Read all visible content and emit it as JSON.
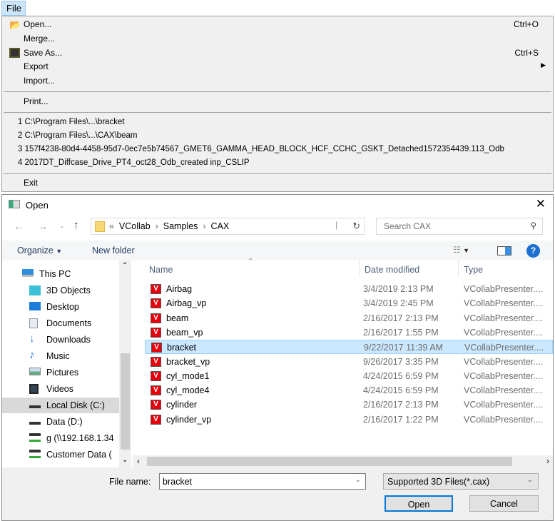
{
  "menubar": {
    "file_label": "File"
  },
  "file_menu": {
    "items": [
      {
        "label": "Open...",
        "shortcut": "Ctrl+O",
        "icon": "open-folder-icon"
      },
      {
        "label": "Merge..."
      },
      {
        "label": "Save As...",
        "shortcut": "Ctrl+S",
        "icon": "floppy-disk-icon"
      },
      {
        "label": "Export",
        "submenu": true
      },
      {
        "label": "Import..."
      }
    ],
    "print_label": "Print...",
    "recent": [
      "1 C:\\Program Files\\...\\bracket",
      "2 C:\\Program Files\\...\\CAX\\beam",
      "3 157f4238-80d4-4458-95d7-0ec7e5b74567_GMET6_GAMMA_HEAD_BLOCK_HCF_CCHC_GSKT_Detached1572354439.113_Odb",
      "4 2017DT_Diffcase_Drive_PT4_oct28_Odb_created inp_CSLIP"
    ],
    "exit_label": "Exit"
  },
  "dialog": {
    "title": "Open",
    "breadcrumb": {
      "overflow": "«",
      "parts": [
        "VCollab",
        "Samples",
        "CAX"
      ]
    },
    "search_placeholder": "Search CAX",
    "toolbar": {
      "organize": "Organize",
      "new_folder": "New folder"
    },
    "nav": [
      {
        "label": "This PC",
        "icon": "computer-icon"
      },
      {
        "label": "3D Objects",
        "icon": "3d-objects-icon"
      },
      {
        "label": "Desktop",
        "icon": "desktop-icon"
      },
      {
        "label": "Documents",
        "icon": "documents-icon"
      },
      {
        "label": "Downloads",
        "icon": "downloads-icon"
      },
      {
        "label": "Music",
        "icon": "music-icon"
      },
      {
        "label": "Pictures",
        "icon": "pictures-icon"
      },
      {
        "label": "Videos",
        "icon": "videos-icon"
      },
      {
        "label": "Local Disk (C:)",
        "icon": "drive-icon",
        "selected": true
      },
      {
        "label": "Data (D:)",
        "icon": "drive-icon"
      },
      {
        "label": "g (\\\\192.168.1.34",
        "icon": "network-drive-icon"
      },
      {
        "label": "Customer Data (",
        "icon": "network-drive-icon"
      }
    ],
    "columns": [
      "Name",
      "Date modified",
      "Type"
    ],
    "files": [
      {
        "name": "Airbag",
        "date": "3/4/2019 2:13 PM",
        "type": "VCollabPresenter...."
      },
      {
        "name": "Airbag_vp",
        "date": "3/4/2019 2:45 PM",
        "type": "VCollabPresenter...."
      },
      {
        "name": "beam",
        "date": "2/16/2017 2:13 PM",
        "type": "VCollabPresenter...."
      },
      {
        "name": "beam_vp",
        "date": "2/16/2017 1:55 PM",
        "type": "VCollabPresenter...."
      },
      {
        "name": "bracket",
        "date": "9/22/2017 11:39 AM",
        "type": "VCollabPresenter....",
        "selected": true
      },
      {
        "name": "bracket_vp",
        "date": "9/26/2017 3:35 PM",
        "type": "VCollabPresenter...."
      },
      {
        "name": "cyl_mode1",
        "date": "4/24/2015 6:59 PM",
        "type": "VCollabPresenter...."
      },
      {
        "name": "cyl_mode4",
        "date": "4/24/2015 6:59 PM",
        "type": "VCollabPresenter...."
      },
      {
        "name": "cylinder",
        "date": "2/16/2017 2:13 PM",
        "type": "VCollabPresenter...."
      },
      {
        "name": "cylinder_vp",
        "date": "2/16/2017 1:22 PM",
        "type": "VCollabPresenter...."
      }
    ],
    "file_name_label": "File name:",
    "file_name_value": "bracket",
    "file_type": "Supported 3D Files(*.cax)",
    "open_label": "Open",
    "cancel_label": "Cancel",
    "colors": {
      "selection": "#cce8ff",
      "file_icon": "#e8000c",
      "accent": "#0078d7"
    }
  }
}
